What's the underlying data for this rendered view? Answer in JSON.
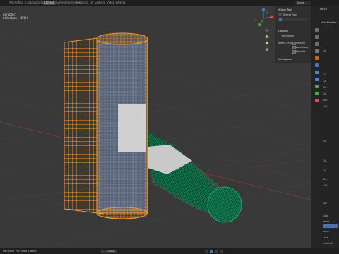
{
  "workspace_tabs": [
    {
      "label": "Animation"
    },
    {
      "label": "Compositing"
    },
    {
      "label": "Default",
      "active": true
    },
    {
      "label": "Geometry Nodes"
    },
    {
      "label": "Scripting"
    },
    {
      "label": "UV Editing"
    },
    {
      "label": "Video Editing"
    }
  ],
  "scene_field": "Scene",
  "viewport": {
    "mode_line": "ographic",
    "collection_line": "Collection | MESH"
  },
  "npanel": {
    "active_tool_header": "Active Tool",
    "tool_name": "Select Box",
    "options_header": "Options",
    "transform_label": "Transform",
    "affect_only_label": "Affect Only",
    "origins_label": "Origins",
    "locations_label": "Locations",
    "parents_label": "Parents",
    "workspace_header": "Workspace"
  },
  "right_panel": {
    "object_label": "MESH",
    "add_modifier_label": "Add Modifier",
    "rows": [
      "Co",
      "Co",
      "Co",
      "Co",
      "Co",
      "Sim",
      "Coll",
      "Co",
      "Co",
      "Co",
      "Sim",
      "Coll",
      "Cor",
      "Colo",
      "Vertic",
      "Layer",
      "Lock",
      "Levels Vi"
    ]
  },
  "status": {
    "left_items": [
      "Pan View",
      "Pan View",
      "Object"
    ],
    "zoom": "Global"
  },
  "colors": {
    "orange_wire": "#f29a2e",
    "blue_wire": "#7d8ba6",
    "green_wire": "#1fa36a",
    "accent": "#4772b3"
  },
  "icons": [
    "gizmo-axes-icon",
    "zoom-icon",
    "hand-pan-icon",
    "camera-icon",
    "grid-icon"
  ]
}
